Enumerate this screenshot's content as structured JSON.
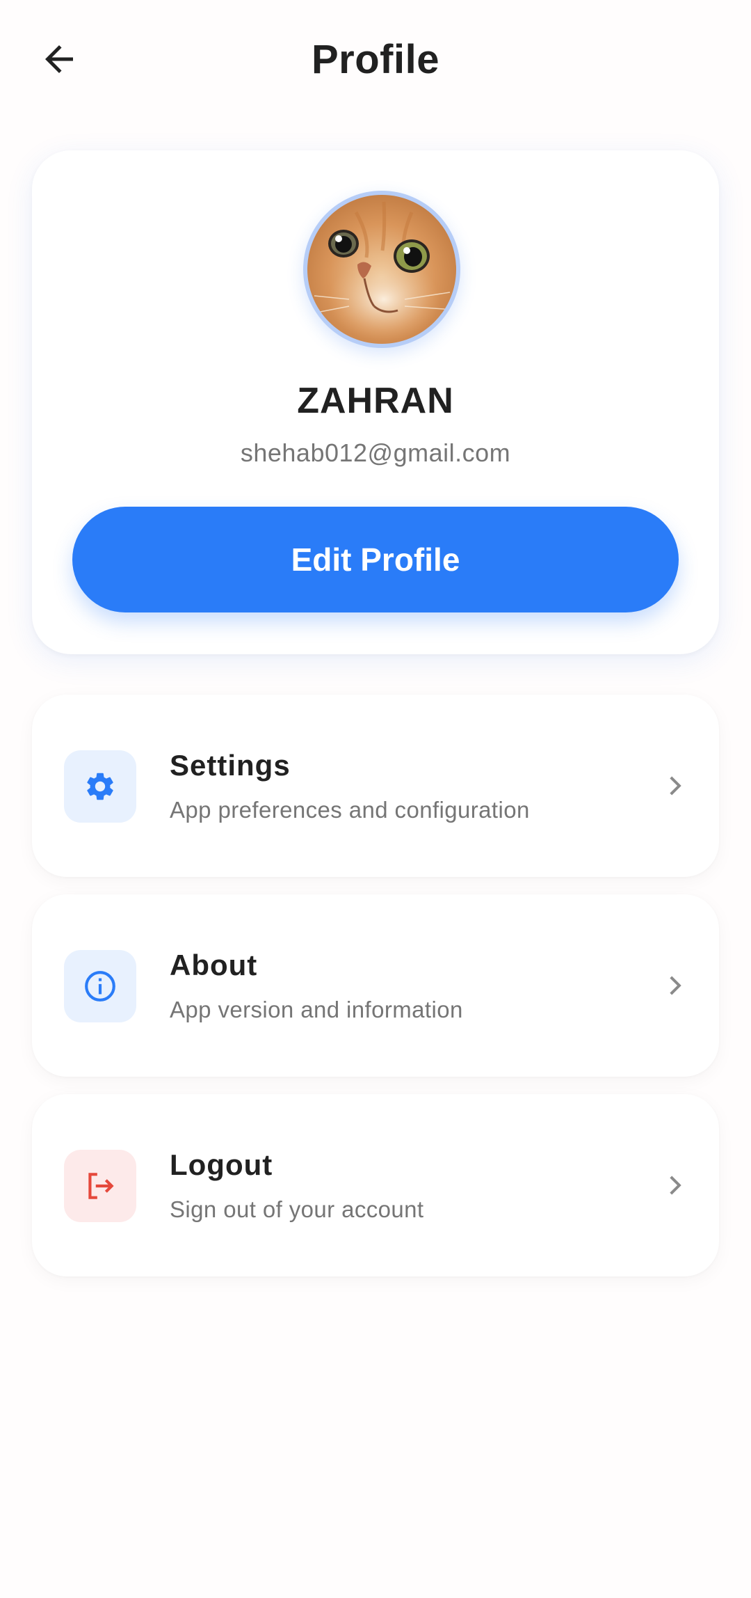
{
  "header": {
    "title": "Profile",
    "back_icon": "arrow-back-icon"
  },
  "profile": {
    "name": "ZAHRAN",
    "email": "shehab012@gmail.com",
    "avatar": "cat-photo-avatar",
    "edit_button_label": "Edit Profile"
  },
  "menu": {
    "items": [
      {
        "title": "Settings",
        "subtitle": "App preferences and configuration",
        "icon": "gear-icon",
        "icon_color": "#2a7cf8",
        "icon_bg": "#e8f1fe"
      },
      {
        "title": "About",
        "subtitle": "App version and information",
        "icon": "info-icon",
        "icon_color": "#2a7cf8",
        "icon_bg": "#e8f1fe"
      },
      {
        "title": "Logout",
        "subtitle": "Sign out of your account",
        "icon": "logout-icon",
        "icon_color": "#e5483b",
        "icon_bg": "#fdeaea"
      }
    ],
    "chevron_icon": "chevron-right-icon"
  },
  "colors": {
    "primary": "#2a7cf8",
    "background": "#fffdfd",
    "text_primary": "#212121",
    "text_secondary": "#757575",
    "danger": "#e5483b"
  }
}
